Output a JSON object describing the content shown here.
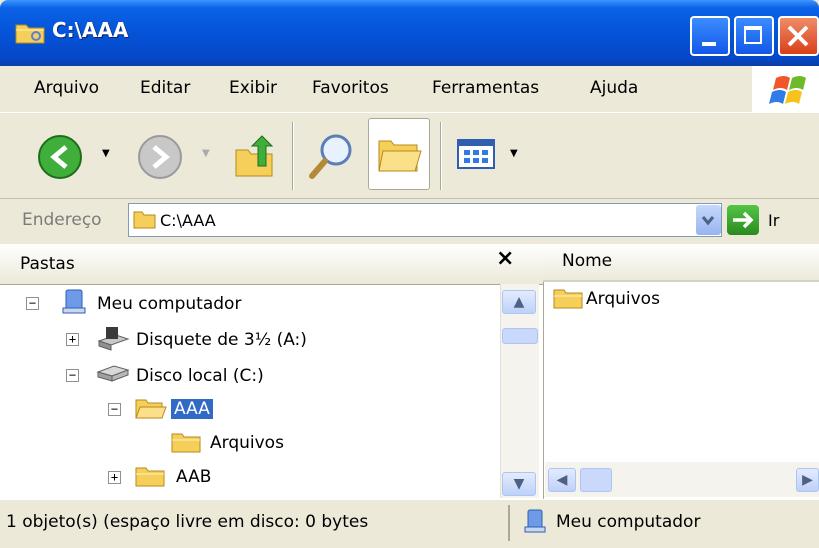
{
  "window": {
    "title": "C:\\AAA"
  },
  "menu": [
    "Arquivo",
    "Editar",
    "Exibir",
    "Favoritos",
    "Ferramentas",
    "Ajuda"
  ],
  "address": {
    "label": "Endereço",
    "value": "C:\\AAA",
    "go_label": "Ir"
  },
  "folders_pane": {
    "title": "Pastas",
    "tree": [
      {
        "label": "Meu computador",
        "icon": "computer-icon",
        "expander": "−"
      },
      {
        "label": "Disquete de 3½ (A:)",
        "icon": "floppy-drive-icon",
        "expander": "+"
      },
      {
        "label": "Disco local (C:)",
        "icon": "hard-drive-icon",
        "expander": "−"
      },
      {
        "label": "AAA",
        "icon": "folder-open-icon",
        "expander": "−",
        "selected": true
      },
      {
        "label": "Arquivos",
        "icon": "folder-icon"
      },
      {
        "label": "AAB",
        "icon": "folder-icon",
        "expander": "+"
      }
    ]
  },
  "file_pane": {
    "column_header": "Nome",
    "items": [
      {
        "label": "Arquivos",
        "icon": "folder-icon"
      }
    ]
  },
  "status": {
    "left": "1 objeto(s) (espaço livre em disco: 0 bytes",
    "right": "Meu computador"
  },
  "colors": {
    "titlebar": "#0553d8",
    "selection": "#316ac5",
    "chrome": "#ece9d8",
    "folder": "#f5cf5a"
  }
}
